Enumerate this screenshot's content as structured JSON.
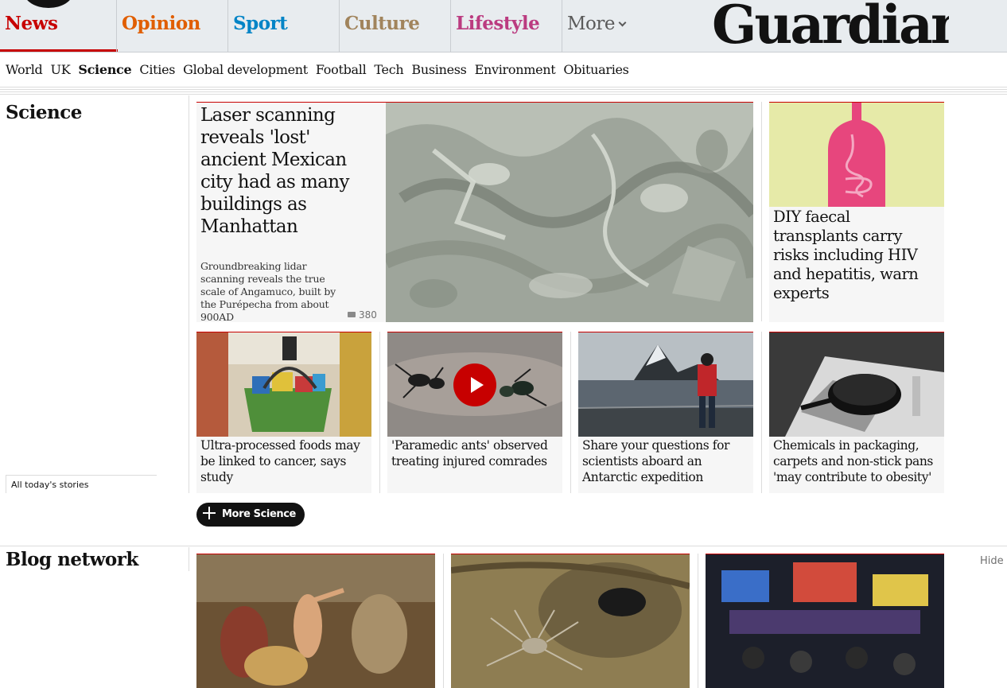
{
  "header": {
    "brand": {
      "line1": "The",
      "line2": "Guardian"
    },
    "pillars": [
      {
        "label": "News",
        "color": "#c70000"
      },
      {
        "label": "Opinion",
        "color": "#e05e00"
      },
      {
        "label": "Sport",
        "color": "#0084c6"
      },
      {
        "label": "Culture",
        "color": "#a1845c"
      },
      {
        "label": "Lifestyle",
        "color": "#bb3b80"
      }
    ],
    "more_label": "More"
  },
  "subnav": {
    "items": [
      "World",
      "UK",
      "Science",
      "Cities",
      "Global development",
      "Football",
      "Tech",
      "Business",
      "Environment",
      "Obituaries"
    ],
    "active": "Science"
  },
  "science": {
    "section_title": "Science",
    "lead": {
      "title": "Laser scanning reveals 'lost' ancient Mexican city had as many buildings as Manhattan",
      "standfirst": "Groundbreaking lidar scanning reveals the true scale of Angamuco, built by the Purépecha from about 900AD",
      "comments": "380"
    },
    "side": {
      "title": "DIY faecal transplants carry risks including HIV and hepatitis, warn experts"
    },
    "small": [
      {
        "title": "Ultra-processed foods may be linked to cancer, says study"
      },
      {
        "title": "'Paramedic ants' observed treating injured comrades"
      },
      {
        "title": "Share your questions for scientists aboard an Antarctic expedition"
      },
      {
        "title": "Chemicals in packaging, carpets and non-stick pans 'may contribute to obesity'"
      }
    ],
    "all_stories": "All today's stories",
    "more_button": "More Science"
  },
  "blog": {
    "section_title": "Blog network",
    "hide_label": "Hide"
  },
  "colors": {
    "accent": "#c70000",
    "card_bg": "#f6f6f6",
    "header_bg": "#e8ecef"
  }
}
